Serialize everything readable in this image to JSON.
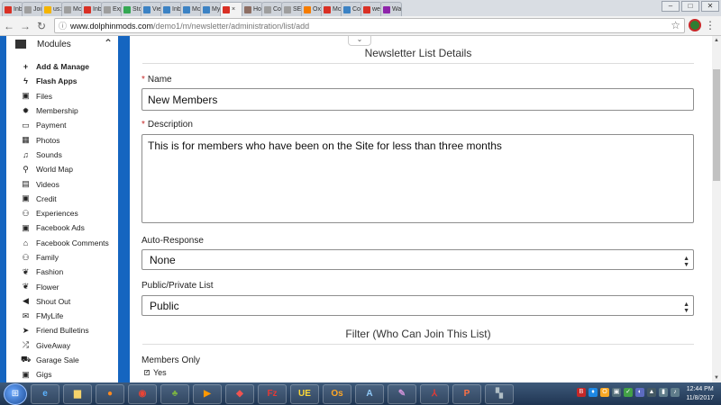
{
  "browser": {
    "tabs": [
      {
        "title": "Inb",
        "color": "#d93025"
      },
      {
        "title": "Joi",
        "color": "#9e9e9e"
      },
      {
        "title": "us:",
        "color": "#f4b400"
      },
      {
        "title": "Mc",
        "color": "#9e9e9e"
      },
      {
        "title": "Inb",
        "color": "#d93025"
      },
      {
        "title": "Exp",
        "color": "#9e9e9e"
      },
      {
        "title": "Sto",
        "color": "#34a853"
      },
      {
        "title": "Vie",
        "color": "#3b82c4"
      },
      {
        "title": "Inb",
        "color": "#3b82c4"
      },
      {
        "title": "Mc",
        "color": "#3b82c4"
      },
      {
        "title": "My",
        "color": "#3b82c4"
      },
      {
        "title": "×",
        "color": "#d93025",
        "active": true
      },
      {
        "title": "Ho",
        "color": "#8d6e63"
      },
      {
        "title": "Co",
        "color": "#9e9e9e"
      },
      {
        "title": "SE",
        "color": "#9e9e9e"
      },
      {
        "title": "Ox",
        "color": "#f57c00"
      },
      {
        "title": "Mc",
        "color": "#d93025"
      },
      {
        "title": "Co",
        "color": "#3b82c4"
      },
      {
        "title": "we",
        "color": "#d93025"
      },
      {
        "title": "Wa",
        "color": "#8e24aa"
      }
    ],
    "url_host": "www.dolphinmods.com",
    "url_path": "/demo1/m/newsletter/administration/list/add"
  },
  "sidebar": {
    "heading": "Modules",
    "items": [
      {
        "label": "Add & Manage",
        "icon": "plus-icon",
        "glyph": "+",
        "bold": true
      },
      {
        "label": "Flash Apps",
        "icon": "bolt-icon",
        "glyph": "ϟ",
        "bold": true
      },
      {
        "label": "Files",
        "icon": "save-icon",
        "glyph": "▣"
      },
      {
        "label": "Membership",
        "icon": "badge-icon",
        "glyph": "✹"
      },
      {
        "label": "Payment",
        "icon": "credit-card-icon",
        "glyph": "▭"
      },
      {
        "label": "Photos",
        "icon": "image-icon",
        "glyph": "▦"
      },
      {
        "label": "Sounds",
        "icon": "music-icon",
        "glyph": "♫"
      },
      {
        "label": "World Map",
        "icon": "map-marker-icon",
        "glyph": "⚲"
      },
      {
        "label": "Videos",
        "icon": "film-icon",
        "glyph": "▤"
      },
      {
        "label": "Credit",
        "icon": "money-icon",
        "glyph": "▣"
      },
      {
        "label": "Experiences",
        "icon": "users-icon",
        "glyph": "⚇"
      },
      {
        "label": "Facebook Ads",
        "icon": "money-icon",
        "glyph": "▣"
      },
      {
        "label": "Facebook Comments",
        "icon": "home-icon",
        "glyph": "⌂"
      },
      {
        "label": "Family",
        "icon": "users-icon",
        "glyph": "⚇"
      },
      {
        "label": "Fashion",
        "icon": "leaf-icon",
        "glyph": "❦"
      },
      {
        "label": "Flower",
        "icon": "leaf-icon",
        "glyph": "❦"
      },
      {
        "label": "Shout Out",
        "icon": "bullhorn-icon",
        "glyph": "◀"
      },
      {
        "label": "FMyLife",
        "icon": "comments-icon",
        "glyph": "✉"
      },
      {
        "label": "Friend Bulletins",
        "icon": "chevron-circle-icon",
        "glyph": "➤"
      },
      {
        "label": "GiveAway",
        "icon": "random-icon",
        "glyph": "⤮"
      },
      {
        "label": "Garage Sale",
        "icon": "cart-icon",
        "glyph": "⛟"
      },
      {
        "label": "Gigs",
        "icon": "money-icon",
        "glyph": "▣"
      }
    ]
  },
  "form": {
    "title": "Newsletter List Details",
    "name_label": "Name",
    "name_value": "New Members",
    "description_label": "Description",
    "description_value": "This is for members who have been on the Site for less than three months",
    "autoresponse_label": "Auto-Response",
    "autoresponse_value": "None",
    "privacy_label": "Public/Private List",
    "privacy_value": "Public",
    "filter_title": "Filter (Who Can Join This List)",
    "members_only_label": "Members Only",
    "members_only_option": "Yes",
    "members_only_checked": true
  },
  "taskbar": {
    "clock_time": "12:44 PM",
    "clock_date": "11/8/2017"
  }
}
